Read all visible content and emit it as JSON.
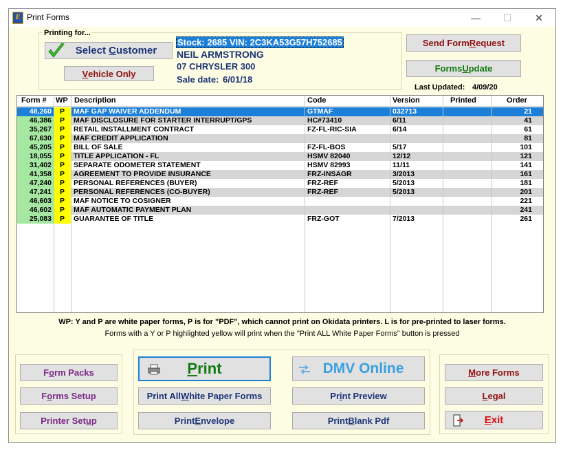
{
  "window": {
    "title": "Print Forms",
    "minimize_glyph": "—",
    "maximize_glyph": "☐",
    "close_glyph": "✕",
    "app_icon_letter": "E"
  },
  "customer": {
    "group_label": "Printing for...",
    "select_customer_pre": "Select ",
    "select_customer_ul": "C",
    "select_customer_post": "ustomer",
    "vehicle_only_ul": "V",
    "vehicle_only_post": "ehicle Only",
    "stock_line": "Stock: 2685  VIN: 2C3KA53G57H752685",
    "name": "NEIL ARMSTRONG",
    "vehicle": "07 CHRYSLER 300",
    "sale_date_label": "Sale date:",
    "sale_date": "6/01/18"
  },
  "top_right": {
    "send_pre": "Send Form ",
    "send_ul": "R",
    "send_post": "equest",
    "forms_update_pre": "Forms ",
    "forms_update_ul": "U",
    "forms_update_post": "pdate",
    "last_updated_label": "Last Updated:",
    "last_updated": "4/09/20"
  },
  "table": {
    "headers": {
      "form": "Form #",
      "wp": "WP",
      "description": "Description",
      "code": "Code",
      "version": "Version",
      "printed": "Printed",
      "order": "Order"
    },
    "rows": [
      {
        "form": "48,260",
        "wp": "P",
        "description": "MAF GAP WAIVER ADDENDUM",
        "code": "GTMAF",
        "version": "032713",
        "printed": "",
        "order": "21"
      },
      {
        "form": "46,386",
        "wp": "P",
        "description": "MAF DISCLOSURE FOR STARTER INTERRUPT/GPS",
        "code": "HC#73410",
        "version": "6/11",
        "printed": "",
        "order": "41"
      },
      {
        "form": "35,267",
        "wp": "P",
        "description": "RETAIL INSTALLMENT CONTRACT",
        "code": "FZ-FL-RIC-SIA",
        "version": "6/14",
        "printed": "",
        "order": "61"
      },
      {
        "form": "67,630",
        "wp": "P",
        "description": "MAF CREDIT APPLICATION",
        "code": "",
        "version": "",
        "printed": "",
        "order": "81"
      },
      {
        "form": "45,205",
        "wp": "P",
        "description": "BILL OF SALE",
        "code": "FZ-FL-BOS",
        "version": "5/17",
        "printed": "",
        "order": "101"
      },
      {
        "form": "18,055",
        "wp": "P",
        "description": "TITLE APPLICATION - FL",
        "code": "HSMV 82040",
        "version": "12/12",
        "printed": "",
        "order": "121"
      },
      {
        "form": "31,402",
        "wp": "P",
        "description": "SEPARATE ODOMETER STATEMENT",
        "code": "HSMV 82993",
        "version": "11/11",
        "printed": "",
        "order": "141"
      },
      {
        "form": "41,358",
        "wp": "P",
        "description": "AGREEMENT TO PROVIDE INSURANCE",
        "code": "FRZ-INSAGR",
        "version": "3/2013",
        "printed": "",
        "order": "161"
      },
      {
        "form": "47,240",
        "wp": "P",
        "description": "PERSONAL REFERENCES (BUYER)",
        "code": "FRZ-REF",
        "version": "5/2013",
        "printed": "",
        "order": "181"
      },
      {
        "form": "47,241",
        "wp": "P",
        "description": "PERSONAL REFERENCES (CO-BUYER)",
        "code": "FRZ-REF",
        "version": "5/2013",
        "printed": "",
        "order": "201"
      },
      {
        "form": "46,603",
        "wp": "P",
        "description": "MAF NOTICE TO COSIGNER",
        "code": "",
        "version": "",
        "printed": "",
        "order": "221"
      },
      {
        "form": "46,602",
        "wp": "P",
        "description": "MAF AUTOMATIC PAYMENT PLAN",
        "code": "",
        "version": "",
        "printed": "",
        "order": "241"
      },
      {
        "form": "25,083",
        "wp": "P",
        "description": "GUARANTEE OF TITLE",
        "code": "FRZ-GOT",
        "version": "7/2013",
        "printed": "",
        "order": "261"
      }
    ]
  },
  "notes": {
    "line1": "WP: Y and P are white paper forms, P is for \"PDF\", which cannot print on Okidata printers. L is for pre-printed to laser forms.",
    "line2": "Forms with a Y or P highlighted yellow will print when the \"Print ALL White Paper Forms\" button is pressed"
  },
  "left_buttons": {
    "form_packs_pre": "F",
    "form_packs_ul": "o",
    "form_packs_post": "rm Packs",
    "forms_setup_pre": "F",
    "forms_setup_ul": "o",
    "forms_setup_post": "rms Setup",
    "printer_setup_pre": "Printer Set",
    "printer_setup_ul": "u",
    "printer_setup_post": "p"
  },
  "center_buttons": {
    "print_ul": "P",
    "print_post": "rint",
    "dmv_online": "DMV Online",
    "print_all_pre": "Print All ",
    "print_all_ul": "W",
    "print_all_post": "hite Paper Forms",
    "print_preview_pre": "Pr",
    "print_preview_ul": "i",
    "print_preview_post": "nt Preview",
    "print_envelope_pre": "Print ",
    "print_envelope_ul": "E",
    "print_envelope_post": "nvelope",
    "print_blank_pre": "Print ",
    "print_blank_ul": "B",
    "print_blank_post": "lank Pdf"
  },
  "right_buttons": {
    "more_forms_ul": "M",
    "more_forms_post": "ore Forms",
    "legal_ul": "L",
    "legal_post": "egal",
    "exit_ul": "E",
    "exit_post": "xit"
  },
  "colors": {
    "selected_row": "#1c7fd8",
    "form_col_green": "#a6e8a1",
    "wp_yellow": "#ffff00",
    "alt_row": "#d6d6d6",
    "accent_navy": "#1d3577",
    "accent_maroon": "#8f1010",
    "accent_green": "#137a13",
    "accent_purple": "#7a2a86"
  }
}
